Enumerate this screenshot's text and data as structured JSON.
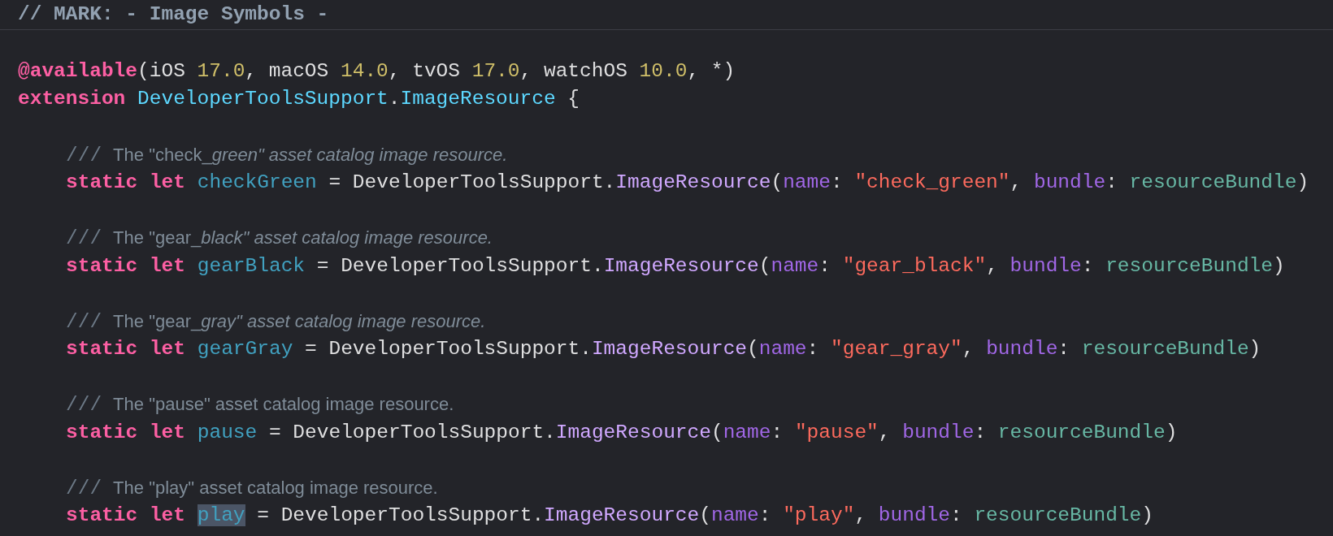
{
  "editor": {
    "mark_header": "// MARK: - Image Symbols -",
    "lines": [
      {
        "kind": "blank"
      },
      {
        "kind": "code",
        "tokens": [
          {
            "kind": "keyword",
            "text": "@available"
          },
          {
            "kind": "plain",
            "text": "(iOS "
          },
          {
            "kind": "number",
            "text": "17.0"
          },
          {
            "kind": "plain",
            "text": ", macOS "
          },
          {
            "kind": "number",
            "text": "14.0"
          },
          {
            "kind": "plain",
            "text": ", tvOS "
          },
          {
            "kind": "number",
            "text": "17.0"
          },
          {
            "kind": "plain",
            "text": ", watchOS "
          },
          {
            "kind": "number",
            "text": "10.0"
          },
          {
            "kind": "plain",
            "text": ", *)"
          }
        ]
      },
      {
        "kind": "code",
        "tokens": [
          {
            "kind": "keyword",
            "text": "extension "
          },
          {
            "kind": "decl-type",
            "text": "DeveloperToolsSupport"
          },
          {
            "kind": "plain",
            "text": "."
          },
          {
            "kind": "decl-type",
            "text": "ImageResource"
          },
          {
            "kind": "plain",
            "text": " {"
          }
        ],
        "children": [
          {
            "kind": "blank"
          },
          {
            "kind": "doc",
            "slashes": "///",
            "parts": [
              {
                "text": "The \"check_",
                "italic": false
              },
              {
                "text": "green\" asset catalog image resource.",
                "italic": true
              }
            ]
          },
          {
            "kind": "code",
            "tokens": [
              {
                "kind": "keyword",
                "text": "static let "
              },
              {
                "kind": "name",
                "text": "checkGreen",
                "selected": false
              },
              {
                "kind": "plain",
                "text": " = DeveloperToolsSupport."
              },
              {
                "kind": "type",
                "text": "ImageResource"
              },
              {
                "kind": "plain",
                "text": "("
              },
              {
                "kind": "param",
                "text": "name"
              },
              {
                "kind": "plain",
                "text": ": "
              },
              {
                "kind": "string",
                "text": "\"check_green\""
              },
              {
                "kind": "plain",
                "text": ", "
              },
              {
                "kind": "param",
                "text": "bundle"
              },
              {
                "kind": "plain",
                "text": ": "
              },
              {
                "kind": "var",
                "text": "resourceBundle"
              },
              {
                "kind": "plain",
                "text": ")"
              }
            ]
          },
          {
            "kind": "blank"
          },
          {
            "kind": "doc",
            "slashes": "///",
            "parts": [
              {
                "text": "The \"gear_",
                "italic": false
              },
              {
                "text": "black\" asset catalog image resource.",
                "italic": true
              }
            ]
          },
          {
            "kind": "code",
            "tokens": [
              {
                "kind": "keyword",
                "text": "static let "
              },
              {
                "kind": "name",
                "text": "gearBlack",
                "selected": false
              },
              {
                "kind": "plain",
                "text": " = DeveloperToolsSupport."
              },
              {
                "kind": "type",
                "text": "ImageResource"
              },
              {
                "kind": "plain",
                "text": "("
              },
              {
                "kind": "param",
                "text": "name"
              },
              {
                "kind": "plain",
                "text": ": "
              },
              {
                "kind": "string",
                "text": "\"gear_black\""
              },
              {
                "kind": "plain",
                "text": ", "
              },
              {
                "kind": "param",
                "text": "bundle"
              },
              {
                "kind": "plain",
                "text": ": "
              },
              {
                "kind": "var",
                "text": "resourceBundle"
              },
              {
                "kind": "plain",
                "text": ")"
              }
            ]
          },
          {
            "kind": "blank"
          },
          {
            "kind": "doc",
            "slashes": "///",
            "parts": [
              {
                "text": "The \"gear_",
                "italic": false
              },
              {
                "text": "gray\" asset catalog image resource.",
                "italic": true
              }
            ]
          },
          {
            "kind": "code",
            "tokens": [
              {
                "kind": "keyword",
                "text": "static let "
              },
              {
                "kind": "name",
                "text": "gearGray",
                "selected": false
              },
              {
                "kind": "plain",
                "text": " = DeveloperToolsSupport."
              },
              {
                "kind": "type",
                "text": "ImageResource"
              },
              {
                "kind": "plain",
                "text": "("
              },
              {
                "kind": "param",
                "text": "name"
              },
              {
                "kind": "plain",
                "text": ": "
              },
              {
                "kind": "string",
                "text": "\"gear_gray\""
              },
              {
                "kind": "plain",
                "text": ", "
              },
              {
                "kind": "param",
                "text": "bundle"
              },
              {
                "kind": "plain",
                "text": ": "
              },
              {
                "kind": "var",
                "text": "resourceBundle"
              },
              {
                "kind": "plain",
                "text": ")"
              }
            ]
          },
          {
            "kind": "blank"
          },
          {
            "kind": "doc",
            "slashes": "///",
            "parts": [
              {
                "text": "The \"pause\" asset catalog image resource.",
                "italic": false
              }
            ]
          },
          {
            "kind": "code",
            "tokens": [
              {
                "kind": "keyword",
                "text": "static let "
              },
              {
                "kind": "name",
                "text": "pause",
                "selected": false
              },
              {
                "kind": "plain",
                "text": " = DeveloperToolsSupport."
              },
              {
                "kind": "type",
                "text": "ImageResource"
              },
              {
                "kind": "plain",
                "text": "("
              },
              {
                "kind": "param",
                "text": "name"
              },
              {
                "kind": "plain",
                "text": ": "
              },
              {
                "kind": "string",
                "text": "\"pause\""
              },
              {
                "kind": "plain",
                "text": ", "
              },
              {
                "kind": "param",
                "text": "bundle"
              },
              {
                "kind": "plain",
                "text": ": "
              },
              {
                "kind": "var",
                "text": "resourceBundle"
              },
              {
                "kind": "plain",
                "text": ")"
              }
            ]
          },
          {
            "kind": "blank"
          },
          {
            "kind": "doc",
            "slashes": "///",
            "parts": [
              {
                "text": "The \"play\" asset catalog image resource.",
                "italic": false
              }
            ]
          },
          {
            "kind": "code",
            "tokens": [
              {
                "kind": "keyword",
                "text": "static let "
              },
              {
                "kind": "name",
                "text": "play",
                "selected": true
              },
              {
                "kind": "plain",
                "text": " = DeveloperToolsSupport."
              },
              {
                "kind": "type",
                "text": "ImageResource"
              },
              {
                "kind": "plain",
                "text": "("
              },
              {
                "kind": "param",
                "text": "name"
              },
              {
                "kind": "plain",
                "text": ": "
              },
              {
                "kind": "string",
                "text": "\"play\""
              },
              {
                "kind": "plain",
                "text": ", "
              },
              {
                "kind": "param",
                "text": "bundle"
              },
              {
                "kind": "plain",
                "text": ": "
              },
              {
                "kind": "var",
                "text": "resourceBundle"
              },
              {
                "kind": "plain",
                "text": ")"
              }
            ]
          }
        ]
      }
    ]
  }
}
